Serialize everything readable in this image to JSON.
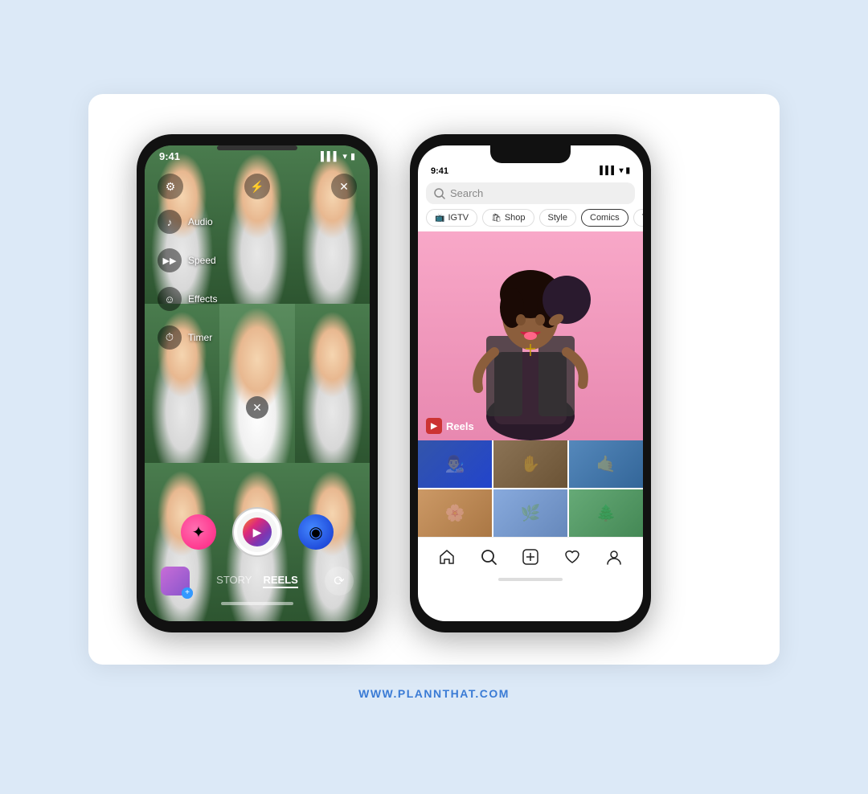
{
  "background_color": "#dce9f7",
  "card_background": "#ffffff",
  "footer": {
    "url": "WWW.PLANNTHAT.COM"
  },
  "phone_left": {
    "status_time": "9:41",
    "mode_story": "STORY",
    "mode_reels": "REELS",
    "menu_items": [
      {
        "icon": "♪",
        "label": "Audio"
      },
      {
        "icon": "⏩",
        "label": "Speed"
      },
      {
        "icon": "😊",
        "label": "Effects"
      },
      {
        "icon": "⏱",
        "label": "Timer"
      }
    ]
  },
  "phone_right": {
    "status_time": "9:41",
    "search_placeholder": "Search",
    "categories": [
      "IGTV",
      "Shop",
      "Style",
      "Comics",
      "TV & Movie"
    ],
    "reels_label": "Reels",
    "nav_items": [
      "home",
      "search",
      "add",
      "heart",
      "person"
    ]
  }
}
